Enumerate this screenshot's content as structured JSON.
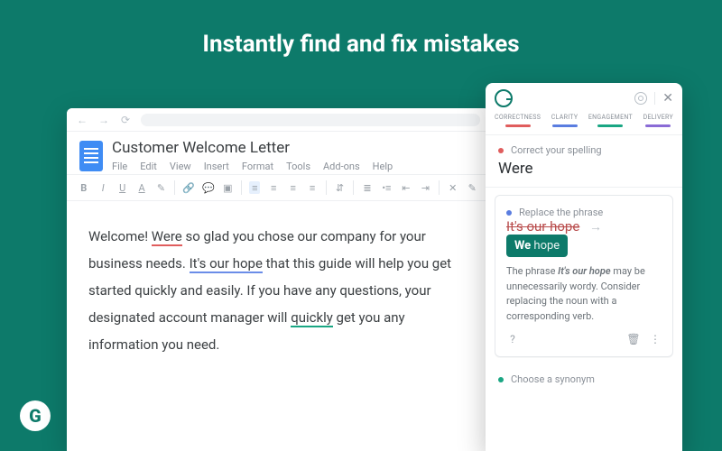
{
  "headline": "Instantly find and fix mistakes",
  "doc": {
    "title": "Customer Welcome Letter",
    "menu": [
      "File",
      "Edit",
      "View",
      "Insert",
      "Format",
      "Tools",
      "Add-ons",
      "Help"
    ],
    "body": {
      "pre1": "Welcome! ",
      "err_red": "Were",
      "post1": " so glad you chose our company for your business needs. ",
      "err_blue": "It's our hope",
      "post2": " that this guide will help you get started quickly and easily. If you have any questions, your designated account manager will ",
      "err_green": "quickly",
      "post3": " get you any information you need."
    }
  },
  "panel": {
    "categories": [
      {
        "label": "CORRECTNESS",
        "color": "red"
      },
      {
        "label": "CLARITY",
        "color": "blue"
      },
      {
        "label": "ENGAGEMENT",
        "color": "green"
      },
      {
        "label": "DELIVERY",
        "color": "purple"
      }
    ],
    "card1": {
      "label": "Correct your spelling",
      "word": "Were"
    },
    "card2": {
      "label": "Replace the phrase",
      "strike": "It's our hope",
      "suggest_bold": "We",
      "suggest_rest": " hope",
      "explain_pre": "The phrase ",
      "explain_em": "It's our hope",
      "explain_post": " may be unnecessarily wordy. Consider replacing the noun with a corresponding verb."
    },
    "card3": {
      "label": "Choose a synonym"
    }
  }
}
